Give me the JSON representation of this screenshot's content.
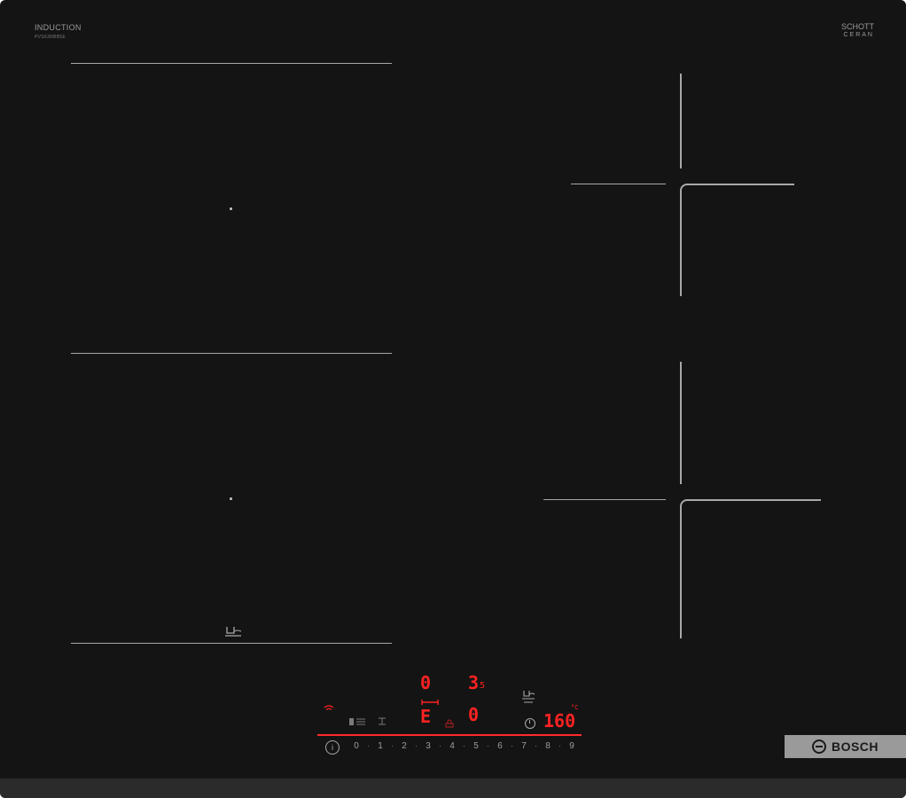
{
  "brand": {
    "top_label": "INDUCTION",
    "model": "PVS63RBB5E",
    "glass_brand_line1": "SCHOTT",
    "glass_brand_line2": "CERAN",
    "logo_text": "BOSCH"
  },
  "zones": {
    "front_left_zone_1_level": "0",
    "front_left_zone_2_level": "3",
    "front_left_zone_2_residual": "5",
    "zone_e_indicator": "E",
    "zone_rear_level": "0",
    "timer_display": "160",
    "timer_unit": "°C"
  },
  "panel": {
    "power_scale": [
      "0",
      "1",
      "2",
      "3",
      "4",
      "5",
      "6",
      "7",
      "8",
      "9"
    ],
    "info_symbol": "i"
  },
  "colors": {
    "glass": "#141414",
    "marking": "#a8a8a8",
    "display_red": "#ff2222",
    "logo_plate": "#9a9a9a"
  },
  "icons": [
    "pot-sensor-icon",
    "wifi-icon",
    "flex-zone-icon",
    "timer-icon",
    "info-icon",
    "lock-icon",
    "bosch-logo-icon"
  ]
}
